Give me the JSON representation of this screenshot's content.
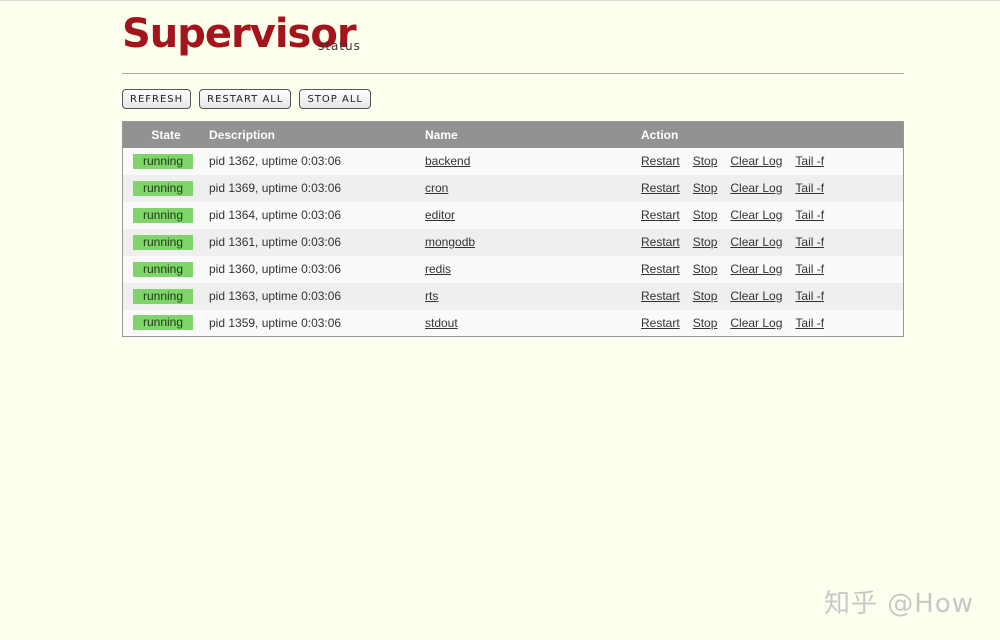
{
  "header": {
    "logo": "Supervisor",
    "subtitle": "status"
  },
  "toolbar": {
    "refresh_label": "REFRESH",
    "restart_all_label": "RESTART ALL",
    "stop_all_label": "STOP ALL"
  },
  "table": {
    "columns": {
      "state": "State",
      "description": "Description",
      "name": "Name",
      "action": "Action"
    },
    "rows": [
      {
        "state": "running",
        "description": "pid 1362, uptime 0:03:06",
        "name": "backend",
        "actions": [
          "Restart",
          "Stop",
          "Clear Log",
          "Tail -f"
        ]
      },
      {
        "state": "running",
        "description": "pid 1369, uptime 0:03:06",
        "name": "cron",
        "actions": [
          "Restart",
          "Stop",
          "Clear Log",
          "Tail -f"
        ]
      },
      {
        "state": "running",
        "description": "pid 1364, uptime 0:03:06",
        "name": "editor",
        "actions": [
          "Restart",
          "Stop",
          "Clear Log",
          "Tail -f"
        ]
      },
      {
        "state": "running",
        "description": "pid 1361, uptime 0:03:06",
        "name": "mongodb",
        "actions": [
          "Restart",
          "Stop",
          "Clear Log",
          "Tail -f"
        ]
      },
      {
        "state": "running",
        "description": "pid 1360, uptime 0:03:06",
        "name": "redis",
        "actions": [
          "Restart",
          "Stop",
          "Clear Log",
          "Tail -f"
        ]
      },
      {
        "state": "running",
        "description": "pid 1363, uptime 0:03:06",
        "name": "rts",
        "actions": [
          "Restart",
          "Stop",
          "Clear Log",
          "Tail -f"
        ]
      },
      {
        "state": "running",
        "description": "pid 1359, uptime 0:03:06",
        "name": "stdout",
        "actions": [
          "Restart",
          "Stop",
          "Clear Log",
          "Tail -f"
        ]
      }
    ]
  },
  "watermark": "知乎 @How",
  "colors": {
    "logo": "#a4151b",
    "running_badge": "#7fd46a",
    "header_row": "#929292",
    "background": "#fffff0"
  }
}
